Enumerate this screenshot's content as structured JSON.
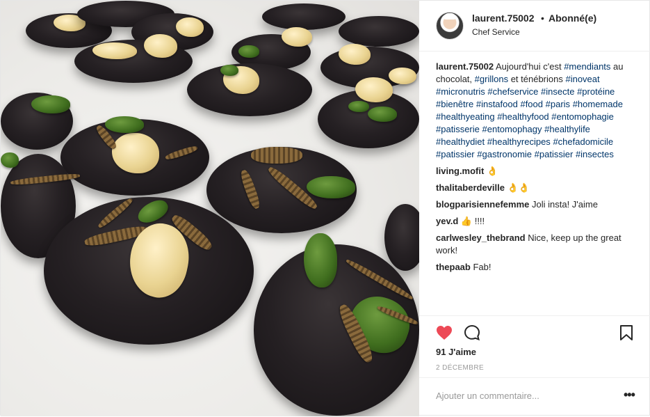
{
  "post": {
    "username": "laurent.75002",
    "separator": "•",
    "follow_state": "Abonné(e)",
    "subtitle": "Chef Service",
    "photo_icon": "post-photo",
    "caption": {
      "username": "laurent.75002",
      "parts": [
        {
          "t": "text",
          "v": "Aujourd'hui c'est "
        },
        {
          "t": "tag",
          "v": "#mendiants"
        },
        {
          "t": "text",
          "v": " au chocolat, "
        },
        {
          "t": "tag",
          "v": "#grillons"
        },
        {
          "t": "text",
          "v": " et ténébrions "
        },
        {
          "t": "tag",
          "v": "#inoveat"
        },
        {
          "t": "text",
          "v": " "
        },
        {
          "t": "tag",
          "v": "#micronutris"
        },
        {
          "t": "text",
          "v": " "
        },
        {
          "t": "tag",
          "v": "#chefservice"
        },
        {
          "t": "text",
          "v": " "
        },
        {
          "t": "tag",
          "v": "#insecte"
        },
        {
          "t": "text",
          "v": " "
        },
        {
          "t": "tag",
          "v": "#protéine"
        },
        {
          "t": "text",
          "v": " "
        },
        {
          "t": "tag",
          "v": "#bienêtre"
        },
        {
          "t": "text",
          "v": " "
        },
        {
          "t": "tag",
          "v": "#instafood"
        },
        {
          "t": "text",
          "v": " "
        },
        {
          "t": "tag",
          "v": "#food"
        },
        {
          "t": "text",
          "v": " "
        },
        {
          "t": "tag",
          "v": "#paris"
        },
        {
          "t": "text",
          "v": " "
        },
        {
          "t": "tag",
          "v": "#homemade"
        },
        {
          "t": "text",
          "v": " "
        },
        {
          "t": "tag",
          "v": "#healthyeating"
        },
        {
          "t": "text",
          "v": " "
        },
        {
          "t": "tag",
          "v": "#healthyfood"
        },
        {
          "t": "text",
          "v": " "
        },
        {
          "t": "tag",
          "v": "#entomophagie"
        },
        {
          "t": "text",
          "v": " "
        },
        {
          "t": "tag",
          "v": "#patisserie"
        },
        {
          "t": "text",
          "v": " "
        },
        {
          "t": "tag",
          "v": "#entomophagy"
        },
        {
          "t": "text",
          "v": " "
        },
        {
          "t": "tag",
          "v": "#healthylife"
        },
        {
          "t": "text",
          "v": " "
        },
        {
          "t": "tag",
          "v": "#healthydiet"
        },
        {
          "t": "text",
          "v": " "
        },
        {
          "t": "tag",
          "v": "#healthyrecipes"
        },
        {
          "t": "text",
          "v": " "
        },
        {
          "t": "tag",
          "v": "#chefadomicile"
        },
        {
          "t": "text",
          "v": " "
        },
        {
          "t": "tag",
          "v": "#patissier"
        },
        {
          "t": "text",
          "v": " "
        },
        {
          "t": "tag",
          "v": "#gastronomie"
        },
        {
          "t": "text",
          "v": " "
        },
        {
          "t": "tag",
          "v": "#patissier"
        },
        {
          "t": "text",
          "v": " "
        },
        {
          "t": "tag",
          "v": "#insectes"
        }
      ]
    },
    "comments": [
      {
        "user": "living.mofit",
        "text": "👌"
      },
      {
        "user": "thalitaberdeville",
        "text": "👌👌"
      },
      {
        "user": "blogparisiennefemme",
        "text": "Joli insta! J'aime"
      },
      {
        "user": "yev.d",
        "text": "👍 !!!!"
      },
      {
        "user": "carlwesley_thebrand",
        "text": "Nice, keep up the great work!"
      },
      {
        "user": "thepaab",
        "text": "Fab!"
      }
    ],
    "likes": "91 J'aime",
    "date": "2 DÉCEMBRE",
    "add_comment_placeholder": "Ajouter un commentaire...",
    "more_label": "•••",
    "icons": {
      "like": "heart-icon",
      "comment": "comment-icon",
      "save": "bookmark-icon",
      "like_color": "#ed4956"
    },
    "colors": {
      "hashtag": "#003569",
      "muted": "#999999",
      "text": "#262626"
    }
  }
}
